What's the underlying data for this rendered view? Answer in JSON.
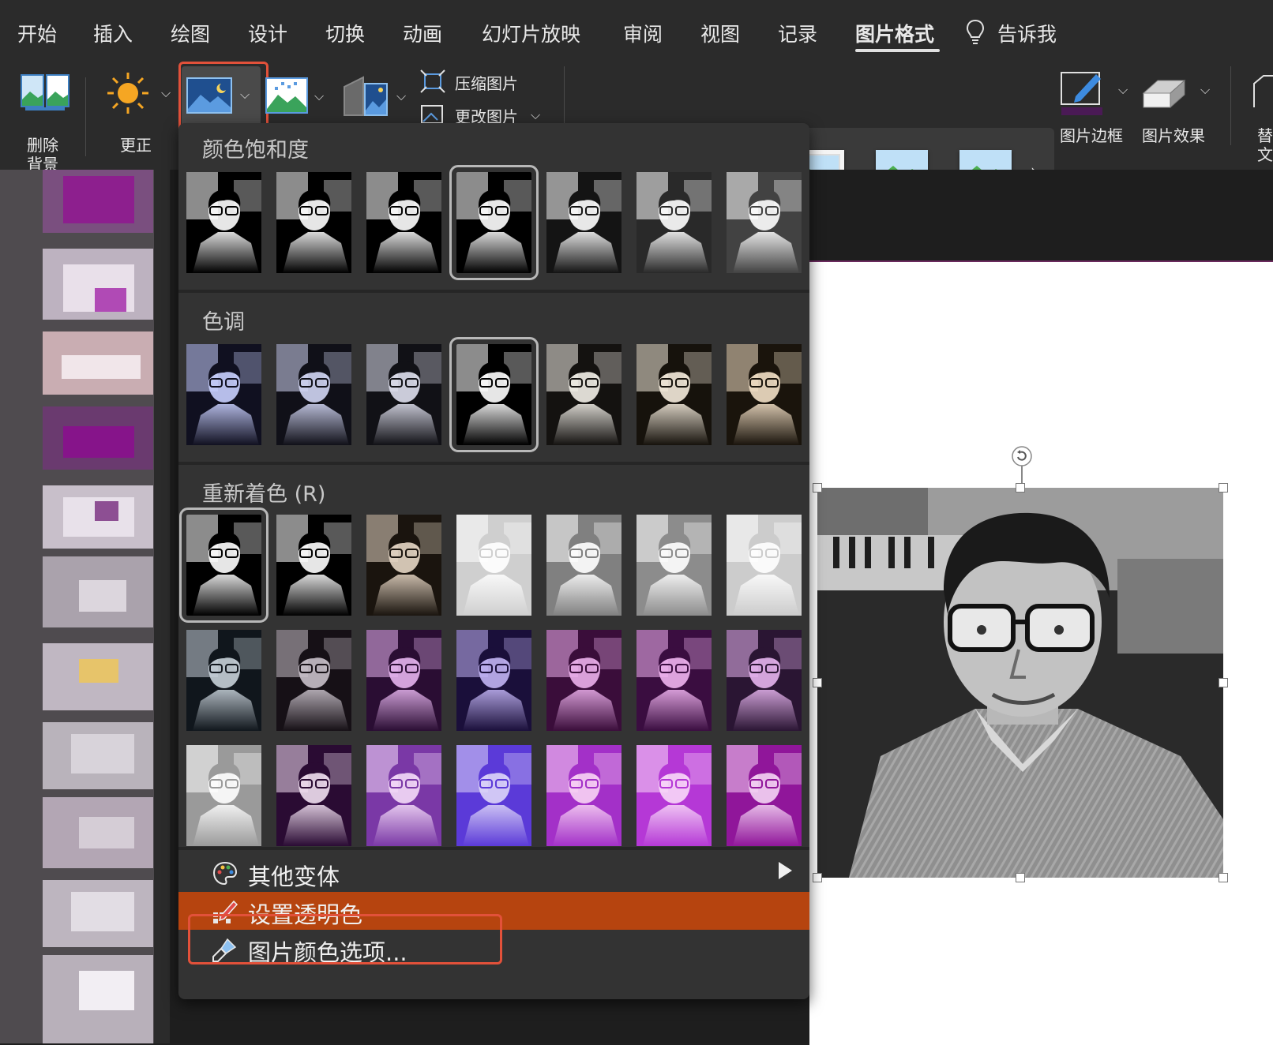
{
  "tabs": [
    {
      "label": "开始"
    },
    {
      "label": "插入"
    },
    {
      "label": "绘图"
    },
    {
      "label": "设计"
    },
    {
      "label": "切换"
    },
    {
      "label": "动画"
    },
    {
      "label": "幻灯片放映"
    },
    {
      "label": "审阅"
    },
    {
      "label": "视图"
    },
    {
      "label": "记录"
    },
    {
      "label": "图片格式"
    },
    {
      "label": "告诉我"
    }
  ],
  "active_tab": "图片格式",
  "ribbon": {
    "remove_bg_line1": "删除",
    "remove_bg_line2": "背景",
    "corrections": "更正",
    "compress": "压缩图片",
    "change_picture": "更改图片",
    "picture_border": "图片边框",
    "picture_effects": "图片效果",
    "alt_text_line1": "替",
    "alt_text_line2": "文"
  },
  "color_menu": {
    "saturation_title": "颜色饱和度",
    "tone_title": "色调",
    "recolor_title": "重新着色 (R)",
    "more_variations": "其他变体",
    "set_transparent": "设置透明色",
    "picture_color_options": "图片颜色选项..."
  },
  "colors": {
    "highlight": "#e2513a",
    "menu_active": "#b6440f",
    "slide_accent": "#6b2a5e"
  },
  "icons": {
    "corrections": "sun-icon",
    "color": "picture-color-icon",
    "artistic": "artistic-effects-icon",
    "transparency": "transparency-icon",
    "tell_me": "lightbulb-icon",
    "more_variations": "palette-icon",
    "set_transparent": "pen-eraser-icon",
    "picture_color_options": "paint-brush-icon",
    "rotate": "rotate-icon"
  }
}
